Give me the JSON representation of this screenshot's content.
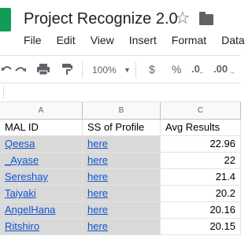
{
  "doc": {
    "title": "Project Recognize 2.0"
  },
  "menu": {
    "items": [
      "File",
      "Edit",
      "View",
      "Insert",
      "Format",
      "Data"
    ]
  },
  "toolbar": {
    "zoom": "100%",
    "currency": "$",
    "percent": "%",
    "decrease_decimals": ".0",
    "increase_decimals": ".00"
  },
  "columns": [
    "A",
    "B",
    "C"
  ],
  "table": {
    "headers": [
      "MAL ID",
      "SS of Profile",
      "Avg Results"
    ],
    "rows": [
      {
        "mal_id": "Qeesa",
        "ss": "here",
        "avg": "22.96"
      },
      {
        "mal_id": "_Ayase",
        "ss": "here",
        "avg": "22"
      },
      {
        "mal_id": "Sereshay",
        "ss": "here",
        "avg": "21.4"
      },
      {
        "mal_id": "Taiyaki",
        "ss": "here",
        "avg": "20.2"
      },
      {
        "mal_id": "AngelHana",
        "ss": "here",
        "avg": "20.16"
      },
      {
        "mal_id": "Ritshiro",
        "ss": "here",
        "avg": "20.15"
      }
    ]
  },
  "colors": {
    "brand": "#0f9d58",
    "link": "#1155cc",
    "selection": "#d9d9d9"
  }
}
